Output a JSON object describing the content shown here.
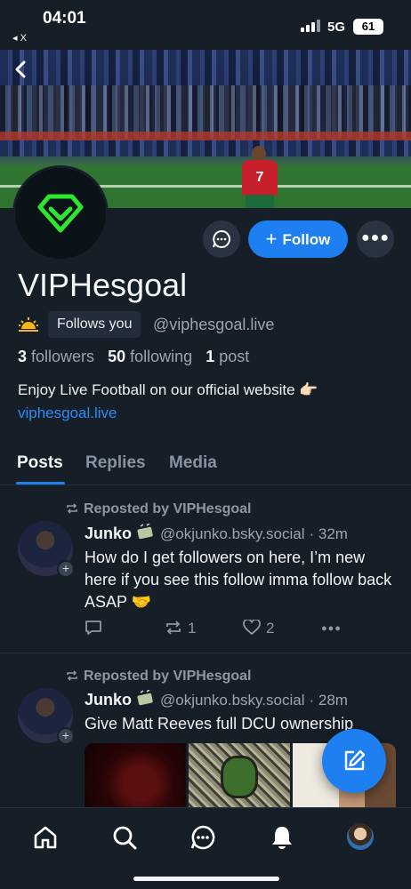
{
  "status_bar": {
    "time": "04:01",
    "back_app": "◂ X",
    "network": "5G",
    "battery": "61"
  },
  "banner": {
    "jersey_number": "7",
    "back_label": "back"
  },
  "profile": {
    "display_name": "VIPHesgoal",
    "follows_you": "Follows you",
    "handle": "@viphesgoal.live",
    "followers_count": "3",
    "followers_label": "followers",
    "following_count": "50",
    "following_label": "following",
    "posts_count": "1",
    "posts_label": "post",
    "bio": "Enjoy Live Football on our official website 👉🏻",
    "bio_link": "viphesgoal.live",
    "follow_label": "Follow"
  },
  "tabs": [
    {
      "label": "Posts",
      "active": true
    },
    {
      "label": "Replies",
      "active": false
    },
    {
      "label": "Media",
      "active": false
    }
  ],
  "posts": [
    {
      "repost_label": "Reposted by VIPHesgoal",
      "author": "Junko",
      "handle": "@okjunko.bsky.social",
      "time": "· 32m",
      "text": "How do I get followers on here, I’m new here if you see this follow imma follow back ASAP 🤝",
      "reposts": "1",
      "likes": "2"
    },
    {
      "repost_label": "Reposted by VIPHesgoal",
      "author": "Junko",
      "handle": "@okjunko.bsky.social",
      "time": "· 28m",
      "text": "Give Matt Reeves full DCU ownership"
    }
  ],
  "icons": {
    "home": "home-icon",
    "search": "search-icon",
    "chat": "chat-icon",
    "notifications": "bell-icon",
    "compose": "compose-icon"
  },
  "colors": {
    "accent": "#1e7ff0",
    "background": "#161e27",
    "logo_green": "#2ee62e"
  }
}
